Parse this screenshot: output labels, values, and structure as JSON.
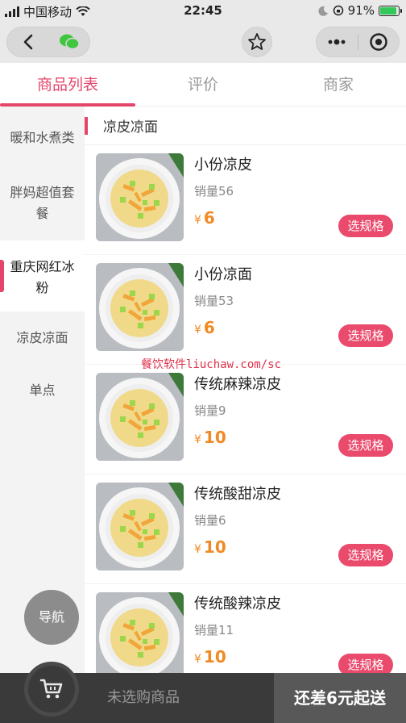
{
  "status_bar": {
    "carrier": "中国移动",
    "time": "22:45",
    "battery": "91%",
    "battery_level": 0.91
  },
  "header": {
    "back_icon": "chevron-left-icon",
    "wechat_icon": "wechat-icon",
    "star_icon": "star-icon",
    "more_icon": "more-dots-icon",
    "close_icon": "target-close-icon"
  },
  "tabs": [
    {
      "label": "商品列表",
      "active": true
    },
    {
      "label": "评价",
      "active": false
    },
    {
      "label": "商家",
      "active": false
    }
  ],
  "side_menu": [
    {
      "label": "暖和水煮类"
    },
    {
      "label": "胖妈超值套\n餐"
    },
    {
      "label": "重庆网红冰\n粉",
      "active": true
    },
    {
      "label": "凉皮凉面"
    },
    {
      "label": "单点"
    }
  ],
  "category": {
    "name": "凉皮凉面"
  },
  "products": [
    {
      "name": "小份凉皮",
      "sales": "销量56",
      "currency": "¥",
      "price": "6",
      "button": "选规格"
    },
    {
      "name": "小份凉面",
      "sales": "销量53",
      "currency": "¥",
      "price": "6",
      "button": "选规格"
    },
    {
      "name": "传统麻辣凉皮",
      "sales": "销量9",
      "currency": "¥",
      "price": "10",
      "button": "选规格"
    },
    {
      "name": "传统酸甜凉皮",
      "sales": "销量6",
      "currency": "¥",
      "price": "10",
      "button": "选规格"
    },
    {
      "name": "传统酸辣凉皮",
      "sales": "销量11",
      "currency": "¥",
      "price": "10",
      "button": "选规格"
    }
  ],
  "watermark": "餐饮软件liuchaw.com/sc",
  "nav_float": {
    "label": "导航"
  },
  "bottom_bar": {
    "cart_icon": "shopping-cart-icon",
    "status": "未选购商品",
    "checkout": "还差6元起送"
  },
  "colors": {
    "accent": "#e5456a",
    "price": "#f08a24",
    "bottom_bar": "#3a3a3a"
  }
}
